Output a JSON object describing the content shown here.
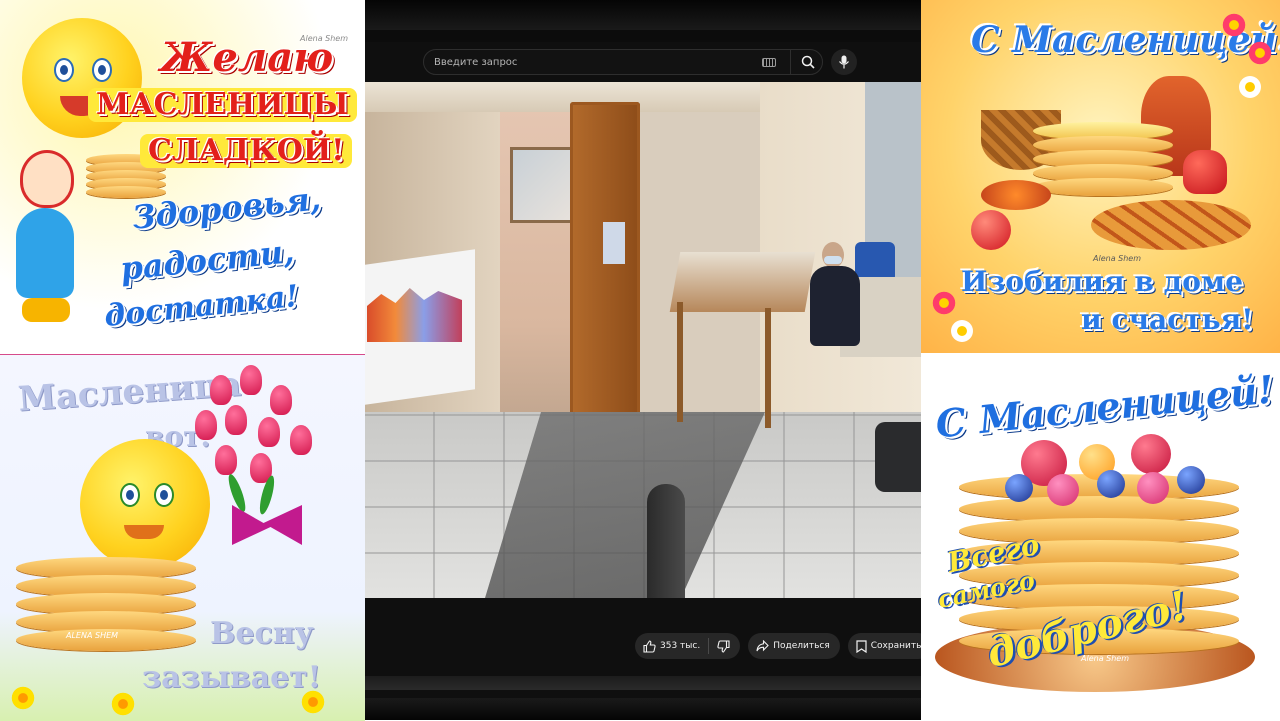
{
  "cards": {
    "top_left": {
      "line1": "Желаю",
      "line2": "масленицы",
      "line3": "сладкой!",
      "line4": "Здоровья,",
      "line5": "радости,",
      "line6": "достатка!",
      "watermark": "Alena Shem"
    },
    "bottom_left": {
      "line1": "Масленица",
      "line2": "вот.",
      "line3": "Весну",
      "line4": "зазывает!",
      "watermark": "ALENA SHEM"
    },
    "top_right": {
      "title": "С Масленицей!",
      "line1": "Изобилия в доме",
      "line2": "и счастья!",
      "watermark": "Alena Shem"
    },
    "bottom_right": {
      "title": "С Масленицей!",
      "line1": "Всего",
      "line2": "самого",
      "line3": "доброго!",
      "watermark": "Alena Shem"
    }
  },
  "player": {
    "search": {
      "placeholder": "Введите запрос"
    },
    "actions": {
      "like_count": "353 тыс.",
      "share_label": "Поделиться",
      "save_label": "Сохранить"
    }
  },
  "icons": {
    "keyboard": "keyboard-icon",
    "search": "search-icon",
    "mic": "mic-icon",
    "like": "thumb-up-icon",
    "dislike": "thumb-down-icon",
    "share": "share-arrow-icon",
    "save": "save-playlist-icon"
  },
  "colors": {
    "player_bg": "#0f0f0f",
    "pill_bg": "#272727",
    "text_light": "#f1f1f1",
    "greeting_red": "#e3201b",
    "greeting_blue": "#1f6fe0"
  }
}
